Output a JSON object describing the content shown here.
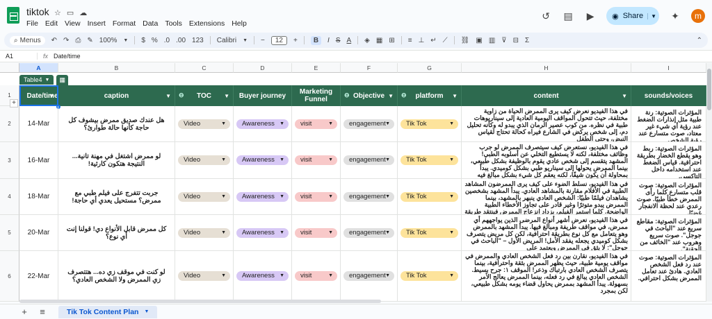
{
  "app": {
    "title": "tiktok",
    "menu": [
      "File",
      "Edit",
      "View",
      "Insert",
      "Format",
      "Data",
      "Tools",
      "Extensions",
      "Help"
    ],
    "share_label": "Share",
    "avatar_letter": "m",
    "accent": "#0b57d0"
  },
  "toolbar": {
    "menus_label": "Menus",
    "zoom": "100%",
    "currency": "$",
    "percent": "%",
    "dec_less": ".0",
    "dec_more": ".00",
    "number_format": "123",
    "font": "Calibri",
    "font_size": "12",
    "bold": "B",
    "italic": "I",
    "strike": "S",
    "underline": "A"
  },
  "formula_bar": {
    "cell_ref": "A1",
    "fx": "fx",
    "value": "Date/time"
  },
  "columns": [
    "A",
    "B",
    "C",
    "D",
    "E",
    "F",
    "G",
    "H",
    "I"
  ],
  "rows": [
    "1",
    "2",
    "3",
    "4",
    "5",
    "6"
  ],
  "table": {
    "name": "Table4",
    "headers": {
      "date": "Date/time",
      "caption": "caption",
      "toc": "TOC",
      "journey": "Buyer journey",
      "funnel": "Marketing Funnel",
      "objective": "Objective",
      "platform": "platform",
      "content": "content",
      "sounds": "sounds/voices"
    },
    "header_color": "#2d6a4f",
    "rows": [
      {
        "date": "14-Mar",
        "caption": "هل عندك صديق ممرض بيشوف كل حاجة كأنها حالة طوارئ؟",
        "toc": "Video",
        "journey": "Awareness",
        "funnel": "visit",
        "objective": "engagement",
        "platform": "Tik Tok",
        "content": "في هذا الفيديو نعرض كيف يرى الممرض الحياة من زاوية مختلفة، حيث تتحول المواقف اليومية العادية إلى سيناريوهات طبية في نظره. من كوب عصير الرمان الذي يبدو له وكأنه تحليل دم، إلى شخص يركض في الشارع فيراه كحالة تحتاج لقياس النبض، وحتى الطفل",
        "sounds": "المؤثرات الصوتية: رنة طبية مثل إنذارات الضغط عند رؤية أي شيء غير معتاد، صوت متسارع عند رؤية الشخص"
      },
      {
        "date": "16-Mar",
        "caption": "لو ممرض اشتغل في مهنة تانية... النتيجة هتكون كارثية!",
        "toc": "Video",
        "journey": "Awareness",
        "funnel": "visit",
        "objective": "engagement",
        "platform": "Tik Tok",
        "content": "في هذا الفيديو، نستعرض كيف سيتصرف الممرض لو جرب وظائف مختلفة، لكنه لا يستطيع التخلي عن أسلوبه الطبي! المشهد يتقسم إلى شخص عادي يقوم بالوظيفة بشكل طبيعي، بينما الممرض يحولها إلى سيناريو طبي بشكل كوميدي. يبدأ بمحاولة أن يكون شيفًا، لكنه يعقم كل شيء بشكل مبالغ فيه",
        "sounds": "المؤثرات الصوتية: ربط وهو يقطع الخضار بطريقة احترافية. قياس الضغط عند استخدامه داخل التاكسي."
      },
      {
        "date": "18-Mar",
        "caption": "جربت تتفرج على فيلم طبي مع ممرض؟ مستحيل يعدي أي حاجة!",
        "toc": "Video",
        "journey": "Awareness",
        "funnel": "visit",
        "objective": "engagement",
        "platform": "Tik Tok",
        "content": "في هذا الفيديو، نسلط الضوء على كيف يرى الممرضون المشاهد الطبية في الأفلام مقارنة بالمشاهد العادي. يبدأ المشهد بشخصين يشاهدان فيلمًا طبيًا: الشخص العادي ينبهر بالمشهد، بينما الممرض يبدو متوترًا وغير قادر على تجاوز الأخطاء الطبية الواضحة. كلما استمر الفيلم، يزداد انزعاج الممرض فينتقد طريقة قياس",
        "sounds": "المؤثرات الصوتية: صوت قلب متسارع كلما رأى الممرض خطأ طبيًا. صوت رعدي عند لحظة الانفجار غضبًا."
      },
      {
        "date": "20-Mar",
        "caption": "كل ممرض قابل الأنواع دي! قولنا إنت أي نوع؟",
        "toc": "Video",
        "journey": "Awareness",
        "funnel": "visit",
        "objective": "engagement",
        "platform": "Tik Tok",
        "content": "في هذا الفيديو، نعرض أشهر أنواع المرضى الذين يواجههم أي ممرض، في مواقف طريفة ومبالغ فيها. يبدأ المشهد بالممرض وهو يتعامل مع كل نوع بطريقة احترافية، لكن كل مريض يتصرف بشكل كوميدي يجعله يفقد الأمل! المريض الأول – \"الباحث في جوجل\": لا يثق في الممرض ويعتمد على",
        "sounds": "المؤثرات الصوتية: مقاطع سريع عند \"الباحث في جوجل\". صوت سريع وهروب عند \"الخائف من الحقنة\"."
      },
      {
        "date": "22-Mar",
        "caption": "لو كنت في موقف زي ده... هتتصرف زي الممرض ولا الشخص العادي؟",
        "toc": "Video",
        "journey": "Awareness",
        "funnel": "visit",
        "objective": "engagement",
        "platform": "Tik Tok",
        "content": "في هذا الفيديو، نقارن بين رد فعل الشخص العادي والممرض في مواقف يومية طبية، حيث يظهر الممرض بثقة واحترافية، بينما يتصرف الشخص العادي بارتباك وذعر! الموقف ١: جرح بسيط. الشخص العادي يبالغ في رد فعله، بينما الممرض يعالج الأمر بسهولة. يبدأ المشهد بممرض يحاول قضاء يومه بشكل طبيعي، لكن بمجرد",
        "sounds": "المؤثرات الصوتية: صوت عند رد فعل الشخص العادي. هادئ عند تعامل الممرض بشكل احترافي."
      }
    ]
  },
  "chip_colors": {
    "toc": "#e6dfd4",
    "journey": "#d7c8f5",
    "funnel": "#f8c9c9",
    "objective": "#e0e0e0",
    "platform": "#fde39b"
  },
  "sheet_tab": "Tik Tok Content Plan"
}
